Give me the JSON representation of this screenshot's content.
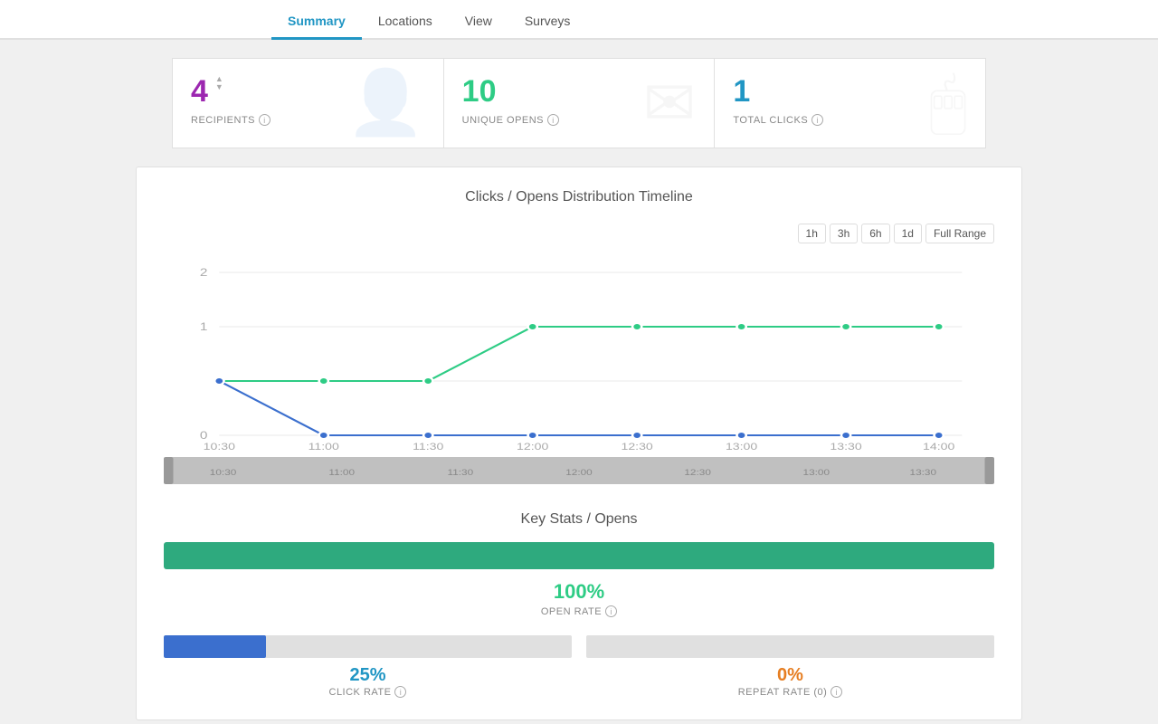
{
  "tabs": [
    {
      "label": "Summary",
      "active": true
    },
    {
      "label": "Locations",
      "active": false
    },
    {
      "label": "View",
      "active": false
    },
    {
      "label": "Surveys",
      "active": false
    }
  ],
  "stats": {
    "recipients": {
      "value": "4",
      "label": "RECIPIENTS",
      "colorClass": "purple"
    },
    "unique_opens": {
      "value": "10",
      "label": "UNIQUE OPENS",
      "colorClass": "green"
    },
    "total_clicks": {
      "value": "1",
      "label": "TOTAL CLICKS",
      "colorClass": "blue"
    }
  },
  "chart": {
    "title": "Clicks / Opens Distribution Timeline",
    "time_ranges": [
      "1h",
      "3h",
      "6h",
      "1d",
      "Full Range"
    ],
    "x_labels": [
      "10:30",
      "11:00",
      "11:30",
      "12:00",
      "12:30",
      "13:00",
      "13:30",
      "14:00"
    ],
    "y_labels": [
      "0",
      "1",
      "2"
    ],
    "minimap_labels": [
      "10:30",
      "11:00",
      "11:30",
      "12:00",
      "12:30",
      "13:00",
      "13:30"
    ]
  },
  "key_stats": {
    "title": "Key Stats / Opens",
    "open_rate": {
      "value": "100%",
      "label": "OPEN RATE"
    },
    "click_rate": {
      "value": "25%",
      "label": "CLICK RATE",
      "fill_percent": 25
    },
    "repeat_rate": {
      "value": "0%",
      "label": "REPEAT RATE (0)",
      "fill_percent": 0
    }
  }
}
